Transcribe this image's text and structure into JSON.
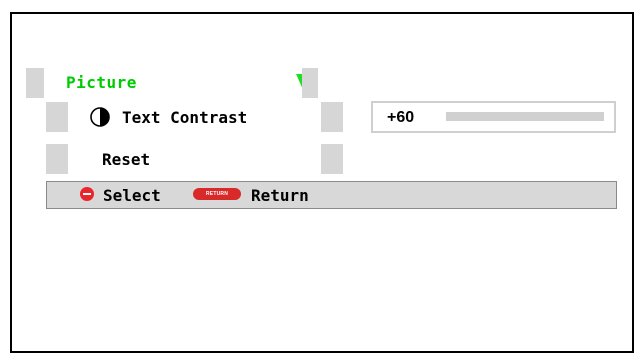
{
  "menu": {
    "header_label": "Picture",
    "items": [
      {
        "label": "Text Contrast",
        "icon": "contrast-icon"
      },
      {
        "label": "Reset"
      }
    ]
  },
  "setting": {
    "value_text": "+60",
    "level_fraction": 1.0
  },
  "footer": {
    "select_label": "Select",
    "return_button_text": "RETURN",
    "return_label": "Return"
  },
  "colors": {
    "header_text": "#00cc00",
    "header_arrow": "#22dd22",
    "button_red": "#e8262b",
    "panel_gray": "#d6d6d6"
  }
}
